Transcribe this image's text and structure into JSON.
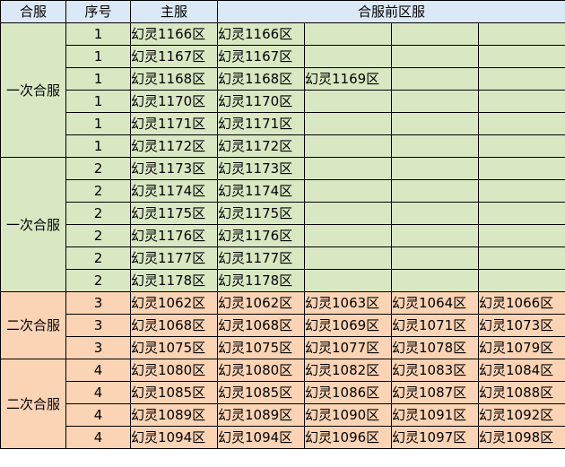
{
  "header": {
    "group": "合服",
    "seq": "序号",
    "main": "主服",
    "before": "合服前区服"
  },
  "groups": [
    {
      "label": "一次合服",
      "rows": [
        {
          "seq": "1",
          "main": "幻灵1166区",
          "before": [
            "幻灵1166区",
            "",
            "",
            ""
          ]
        },
        {
          "seq": "1",
          "main": "幻灵1167区",
          "before": [
            "幻灵1167区",
            "",
            "",
            ""
          ]
        },
        {
          "seq": "1",
          "main": "幻灵1168区",
          "before": [
            "幻灵1168区",
            "幻灵1169区",
            "",
            ""
          ]
        },
        {
          "seq": "1",
          "main": "幻灵1170区",
          "before": [
            "幻灵1170区",
            "",
            "",
            ""
          ]
        },
        {
          "seq": "1",
          "main": "幻灵1171区",
          "before": [
            "幻灵1171区",
            "",
            "",
            ""
          ]
        },
        {
          "seq": "1",
          "main": "幻灵1172区",
          "before": [
            "幻灵1172区",
            "",
            "",
            ""
          ]
        }
      ]
    },
    {
      "label": "一次合服",
      "rows": [
        {
          "seq": "2",
          "main": "幻灵1173区",
          "before": [
            "幻灵1173区",
            "",
            "",
            ""
          ]
        },
        {
          "seq": "2",
          "main": "幻灵1174区",
          "before": [
            "幻灵1174区",
            "",
            "",
            ""
          ]
        },
        {
          "seq": "2",
          "main": "幻灵1175区",
          "before": [
            "幻灵1175区",
            "",
            "",
            ""
          ]
        },
        {
          "seq": "2",
          "main": "幻灵1176区",
          "before": [
            "幻灵1176区",
            "",
            "",
            ""
          ]
        },
        {
          "seq": "2",
          "main": "幻灵1177区",
          "before": [
            "幻灵1177区",
            "",
            "",
            ""
          ]
        },
        {
          "seq": "2",
          "main": "幻灵1178区",
          "before": [
            "幻灵1178区",
            "",
            "",
            ""
          ]
        }
      ]
    },
    {
      "label": "二次合服",
      "rows": [
        {
          "seq": "3",
          "main": "幻灵1062区",
          "before": [
            "幻灵1062区",
            "幻灵1063区",
            "幻灵1064区",
            "幻灵1066区"
          ]
        },
        {
          "seq": "3",
          "main": "幻灵1068区",
          "before": [
            "幻灵1068区",
            "幻灵1069区",
            "幻灵1071区",
            "幻灵1073区"
          ]
        },
        {
          "seq": "3",
          "main": "幻灵1075区",
          "before": [
            "幻灵1075区",
            "幻灵1077区",
            "幻灵1078区",
            "幻灵1079区"
          ]
        }
      ]
    },
    {
      "label": "二次合服",
      "rows": [
        {
          "seq": "4",
          "main": "幻灵1080区",
          "before": [
            "幻灵1080区",
            "幻灵1082区",
            "幻灵1083区",
            "幻灵1084区"
          ]
        },
        {
          "seq": "4",
          "main": "幻灵1085区",
          "before": [
            "幻灵1085区",
            "幻灵1086区",
            "幻灵1087区",
            "幻灵1088区"
          ]
        },
        {
          "seq": "4",
          "main": "幻灵1089区",
          "before": [
            "幻灵1089区",
            "幻灵1090区",
            "幻灵1091区",
            "幻灵1092区"
          ]
        },
        {
          "seq": "4",
          "main": "幻灵1094区",
          "before": [
            "幻灵1094区",
            "幻灵1096区",
            "幻灵1097区",
            "幻灵1098区"
          ]
        }
      ]
    }
  ],
  "colors": {
    "header_bg": "#dbe8f6",
    "first_merge_bg": "#d9e8c3",
    "second_merge_bg": "#fbd4b5",
    "border": "#000000"
  }
}
